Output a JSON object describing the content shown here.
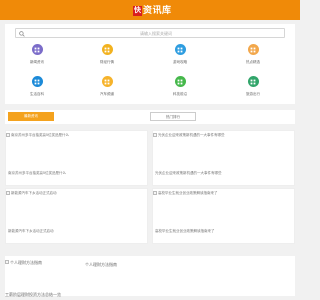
{
  "header": {
    "logo_mark": "快",
    "logo_text": "资讯库",
    "background": "#f08a08"
  },
  "search": {
    "placeholder": "请输入搜索关键词"
  },
  "categories": [
    {
      "label": "新闻资讯",
      "color": "#7b6cc9",
      "icon": "grid-icon"
    },
    {
      "label": "财经行情",
      "color": "#f2b21f",
      "icon": "grid-icon"
    },
    {
      "label": "游戏攻略",
      "color": "#2e9de0",
      "icon": "grid-icon"
    },
    {
      "label": "热点精选",
      "color": "#f2a74b",
      "icon": "grid-icon"
    },
    {
      "label": "生活百科",
      "color": "#1c8ad8",
      "icon": "grid-icon"
    },
    {
      "label": "汽车频道",
      "color": "#f6b32b",
      "icon": "grid-icon"
    },
    {
      "label": "科技前沿",
      "color": "#45b84b",
      "icon": "grid-icon"
    },
    {
      "label": "旅游出行",
      "color": "#31a56a",
      "icon": "grid-icon"
    }
  ],
  "tabs": {
    "active_label": "最新资讯",
    "idle_label": "热门排行"
  },
  "cards": [
    {
      "img_alt": "南京苏州多平台抽奖赢5位奖品是什么",
      "title": "南京苏州多平台抽奖赢5位奖品是什么"
    },
    {
      "img_alt": "光伏企业迎来政策新机遇的一大事件有哪些",
      "title": "光伏企业迎来政策新机遇的一大事件有哪些"
    },
    {
      "img_alt": "新能源汽车下乡活动正式启动",
      "title": "新能源汽车下乡活动正式启动"
    },
    {
      "img_alt": "高校毕业生就业创业政策解读指南来了",
      "title": "高校毕业生就业创业政策解读指南来了"
    }
  ],
  "wide_item": {
    "img_alt": "个人理财方法指南",
    "title": "个人理财方法指南",
    "subtitle": "工薪阶层理财投资方法总结一览"
  }
}
